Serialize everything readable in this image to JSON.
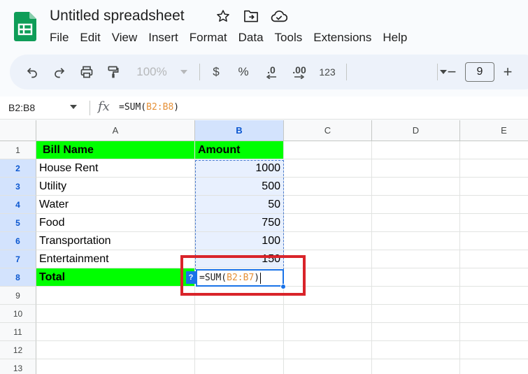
{
  "doc": {
    "title": "Untitled spreadsheet"
  },
  "menu": [
    "File",
    "Edit",
    "View",
    "Insert",
    "Format",
    "Data",
    "Tools",
    "Extensions",
    "Help"
  ],
  "toolbar": {
    "zoom": "100%",
    "currency": "$",
    "percent": "%",
    "decrease_decimal": ".0",
    "increase_decimal": ".00",
    "number_format": "123",
    "font_size": "9",
    "minus": "−",
    "plus": "+"
  },
  "formula_bar": {
    "name_box": "B2:B8",
    "fx": "fx",
    "prefix": "=SUM(",
    "ref": "B2:B8",
    "suffix": ")"
  },
  "columns": [
    "A",
    "B",
    "C",
    "D",
    "E"
  ],
  "rows": [
    "1",
    "2",
    "3",
    "4",
    "5",
    "6",
    "7",
    "8",
    "9",
    "10",
    "11",
    "12",
    "13"
  ],
  "cells": {
    "a1": "Bill Name",
    "b1": "Amount",
    "a2": "House Rent",
    "b2": "1000",
    "a3": "Utility",
    "b3": "500",
    "a4": "Water",
    "b4": "50",
    "a5": "Food",
    "b5": "750",
    "a6": "Transportation",
    "b6": "100",
    "a7": "Entertainment",
    "b7": "150",
    "a8": "Total"
  },
  "editor": {
    "prefix": "=SUM(",
    "ref": "B2:B7",
    "suffix": ")",
    "help": "?"
  },
  "colors": {
    "header_green": "#00ff00",
    "selection_blue": "#1a73e8",
    "ref_orange": "#e69138",
    "highlight_red": "#d9242a"
  }
}
